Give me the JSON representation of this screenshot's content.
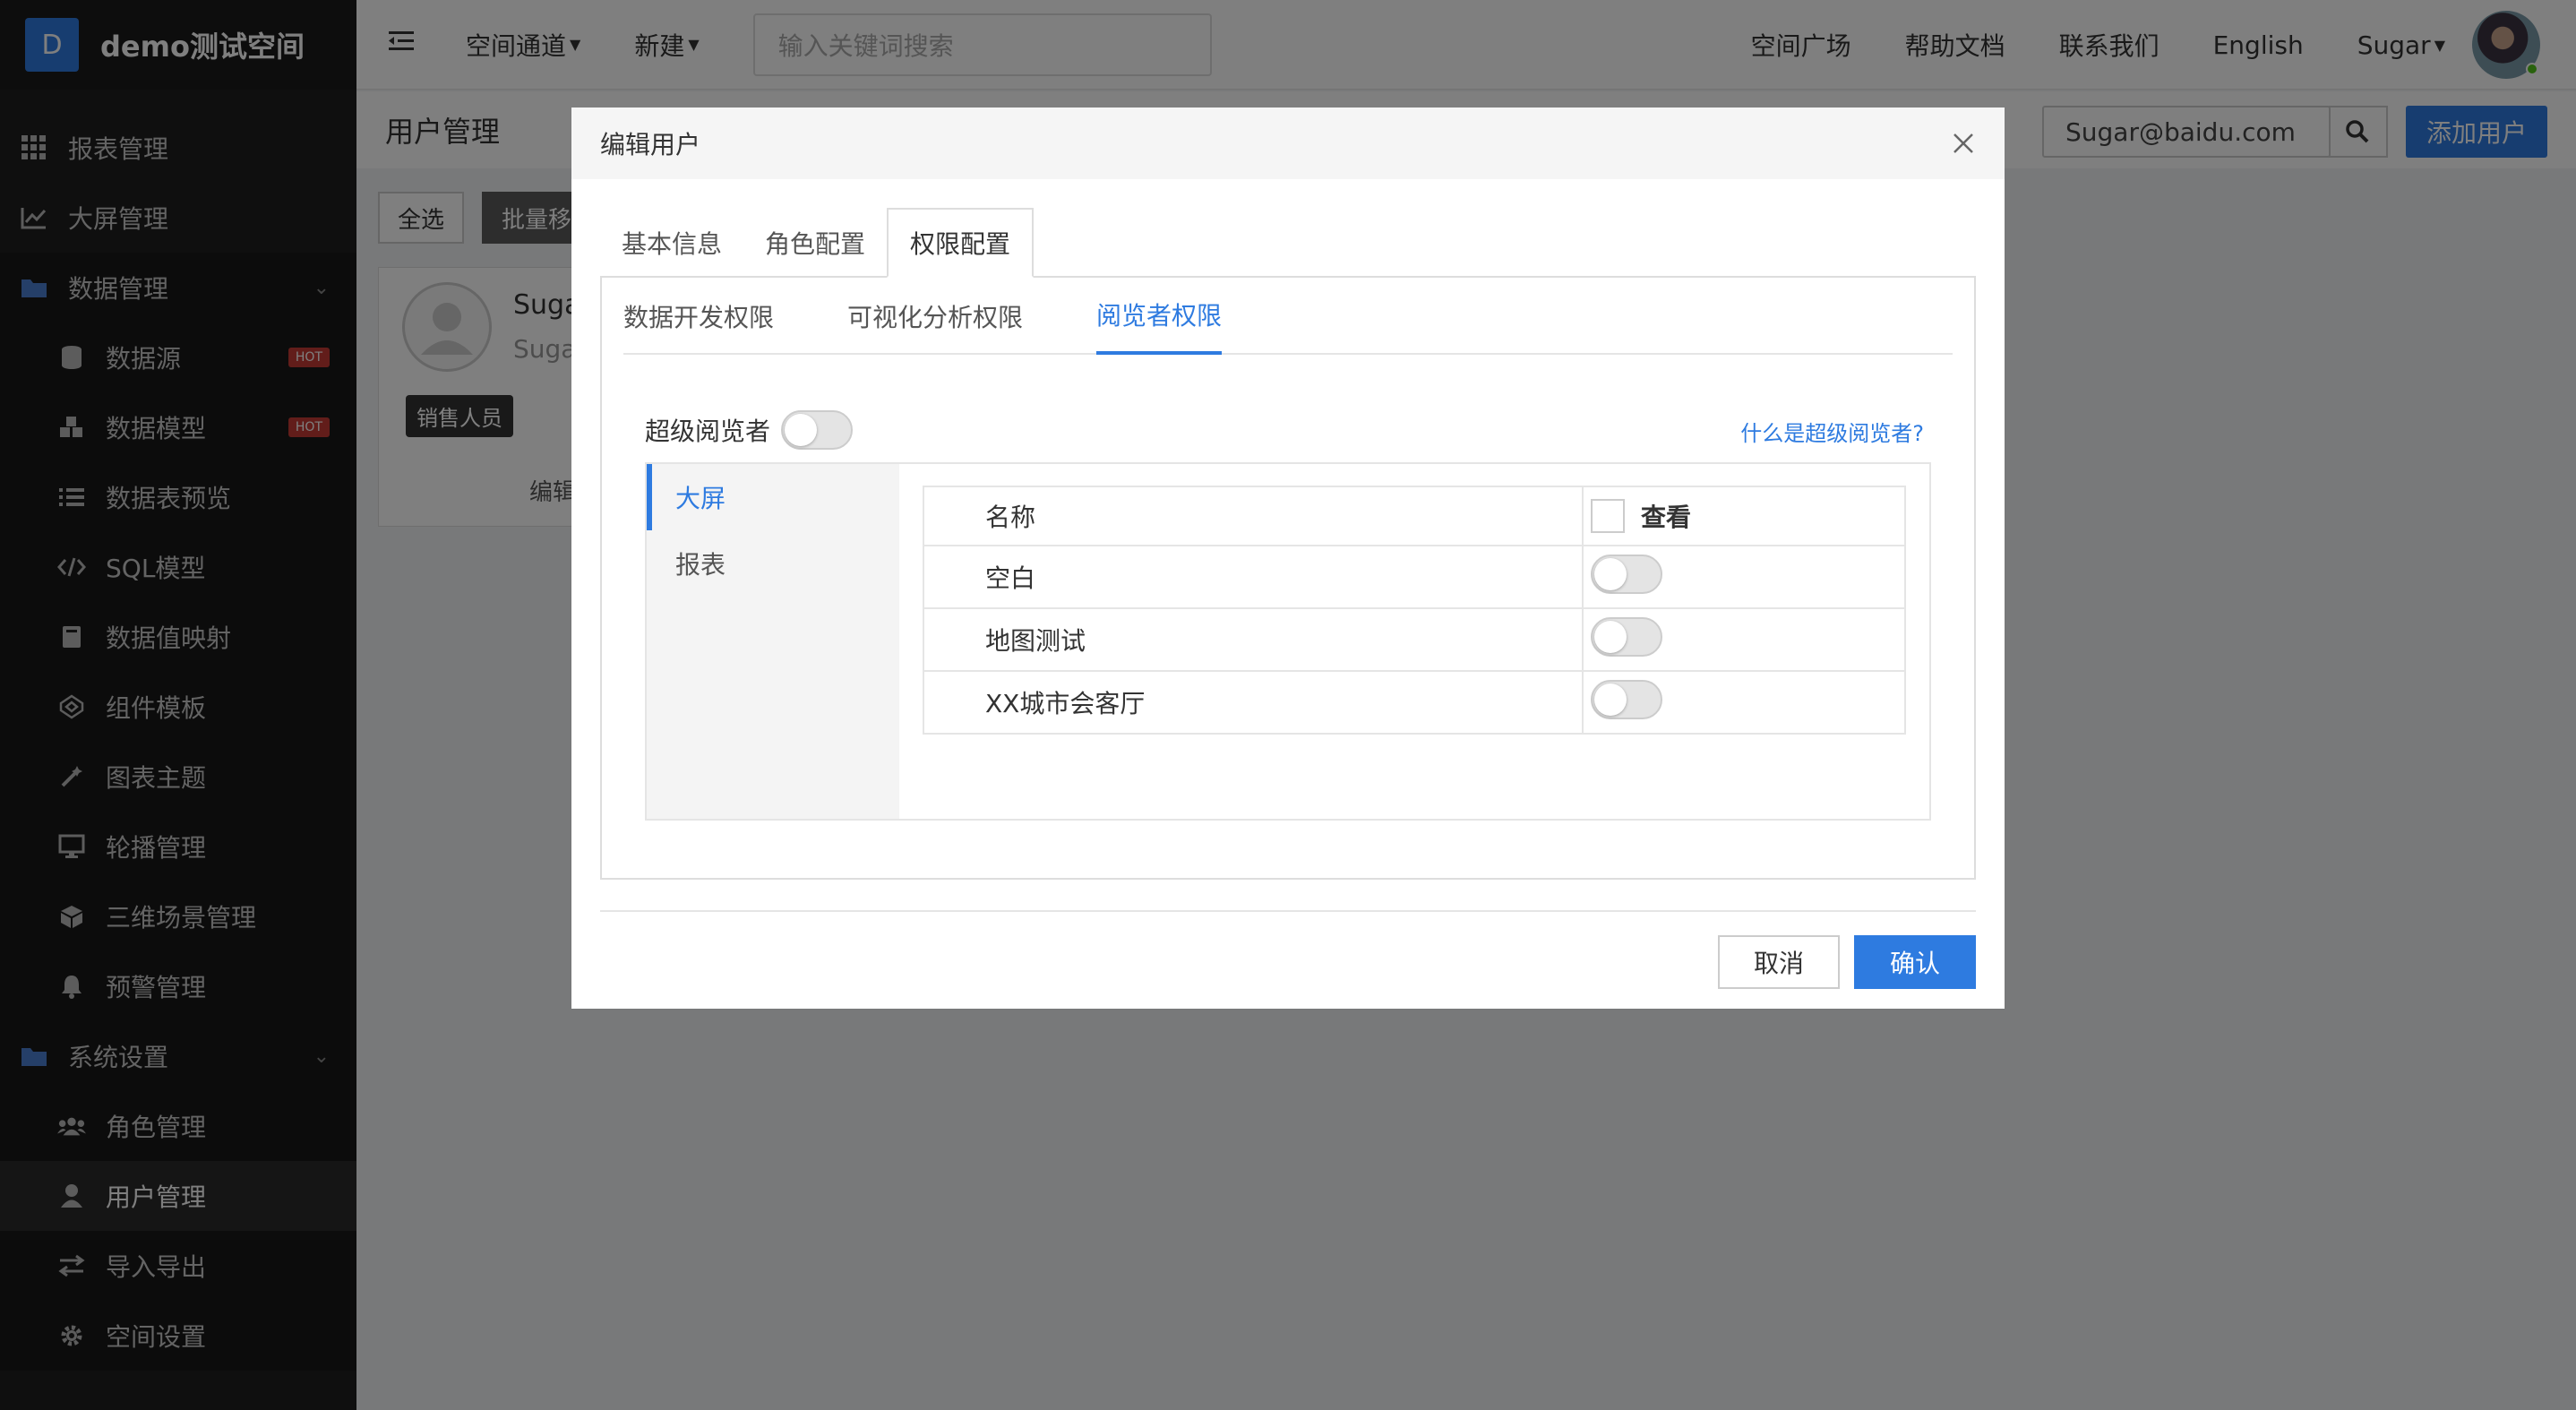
{
  "brand": {
    "logo_letter": "D",
    "name": "demo测试空间"
  },
  "sidebar": {
    "items": [
      {
        "label": "报表管理",
        "icon": "grid-icon",
        "type": "top"
      },
      {
        "label": "大屏管理",
        "icon": "line-chart-icon",
        "type": "top"
      },
      {
        "label": "数据管理",
        "icon": "folder-icon",
        "type": "group"
      },
      {
        "label": "数据源",
        "icon": "database-icon",
        "type": "sub",
        "badge": "HOT"
      },
      {
        "label": "数据模型",
        "icon": "cubes-icon",
        "type": "sub",
        "badge": "HOT"
      },
      {
        "label": "数据表预览",
        "icon": "list-icon",
        "type": "sub"
      },
      {
        "label": "SQL模型",
        "icon": "code-icon",
        "type": "sub"
      },
      {
        "label": "数据值映射",
        "icon": "book-icon",
        "type": "sub"
      },
      {
        "label": "组件模板",
        "icon": "codepen-icon",
        "type": "sub"
      },
      {
        "label": "图表主题",
        "icon": "magic-wand-icon",
        "type": "sub"
      },
      {
        "label": "轮播管理",
        "icon": "monitor-icon",
        "type": "sub"
      },
      {
        "label": "三维场景管理",
        "icon": "cube-icon",
        "type": "sub"
      },
      {
        "label": "预警管理",
        "icon": "bell-icon",
        "type": "sub"
      },
      {
        "label": "系统设置",
        "icon": "folder-icon",
        "type": "group"
      },
      {
        "label": "角色管理",
        "icon": "users-icon",
        "type": "sub"
      },
      {
        "label": "用户管理",
        "icon": "user-icon",
        "type": "sub",
        "active": true
      },
      {
        "label": "导入导出",
        "icon": "exchange-icon",
        "type": "sub"
      },
      {
        "label": "空间设置",
        "icon": "gear-icon",
        "type": "sub"
      }
    ]
  },
  "header": {
    "space_channel": "空间通道",
    "new_label": "新建",
    "search_placeholder": "输入关键词搜索",
    "links": [
      "空间广场",
      "帮助文档",
      "联系我们",
      "English"
    ],
    "user_name": "Sugar"
  },
  "page": {
    "title": "用户管理",
    "search_value": "Sugar@baidu.com",
    "add_user": "添加用户",
    "select_all": "全选",
    "batch_remove": "批量移除"
  },
  "user_card": {
    "name": "Suga",
    "sub": "Suga",
    "tag": "销售人员",
    "edit": "编辑"
  },
  "modal": {
    "title": "编辑用户",
    "tabs": [
      "基本信息",
      "角色配置",
      "权限配置"
    ],
    "active_tab": 2,
    "subtabs": [
      "数据开发权限",
      "可视化分析权限",
      "阅览者权限"
    ],
    "active_subtab": 2,
    "super_viewer_label": "超级阅览者",
    "super_viewer_on": false,
    "what_link": "什么是超级阅览者?",
    "side_items": [
      "大屏",
      "报表"
    ],
    "active_side": 0,
    "table": {
      "col_name": "名称",
      "col_view": "查看",
      "rows": [
        {
          "name": "空白",
          "view": false
        },
        {
          "name": "地图测试",
          "view": false
        },
        {
          "name": "XX城市会客厅",
          "view": false
        }
      ]
    },
    "cancel": "取消",
    "confirm": "确认"
  },
  "colors": {
    "accent": "#2e7be0",
    "sidebar_bg": "#1f1f1f",
    "hot_badge": "#c43b34"
  }
}
